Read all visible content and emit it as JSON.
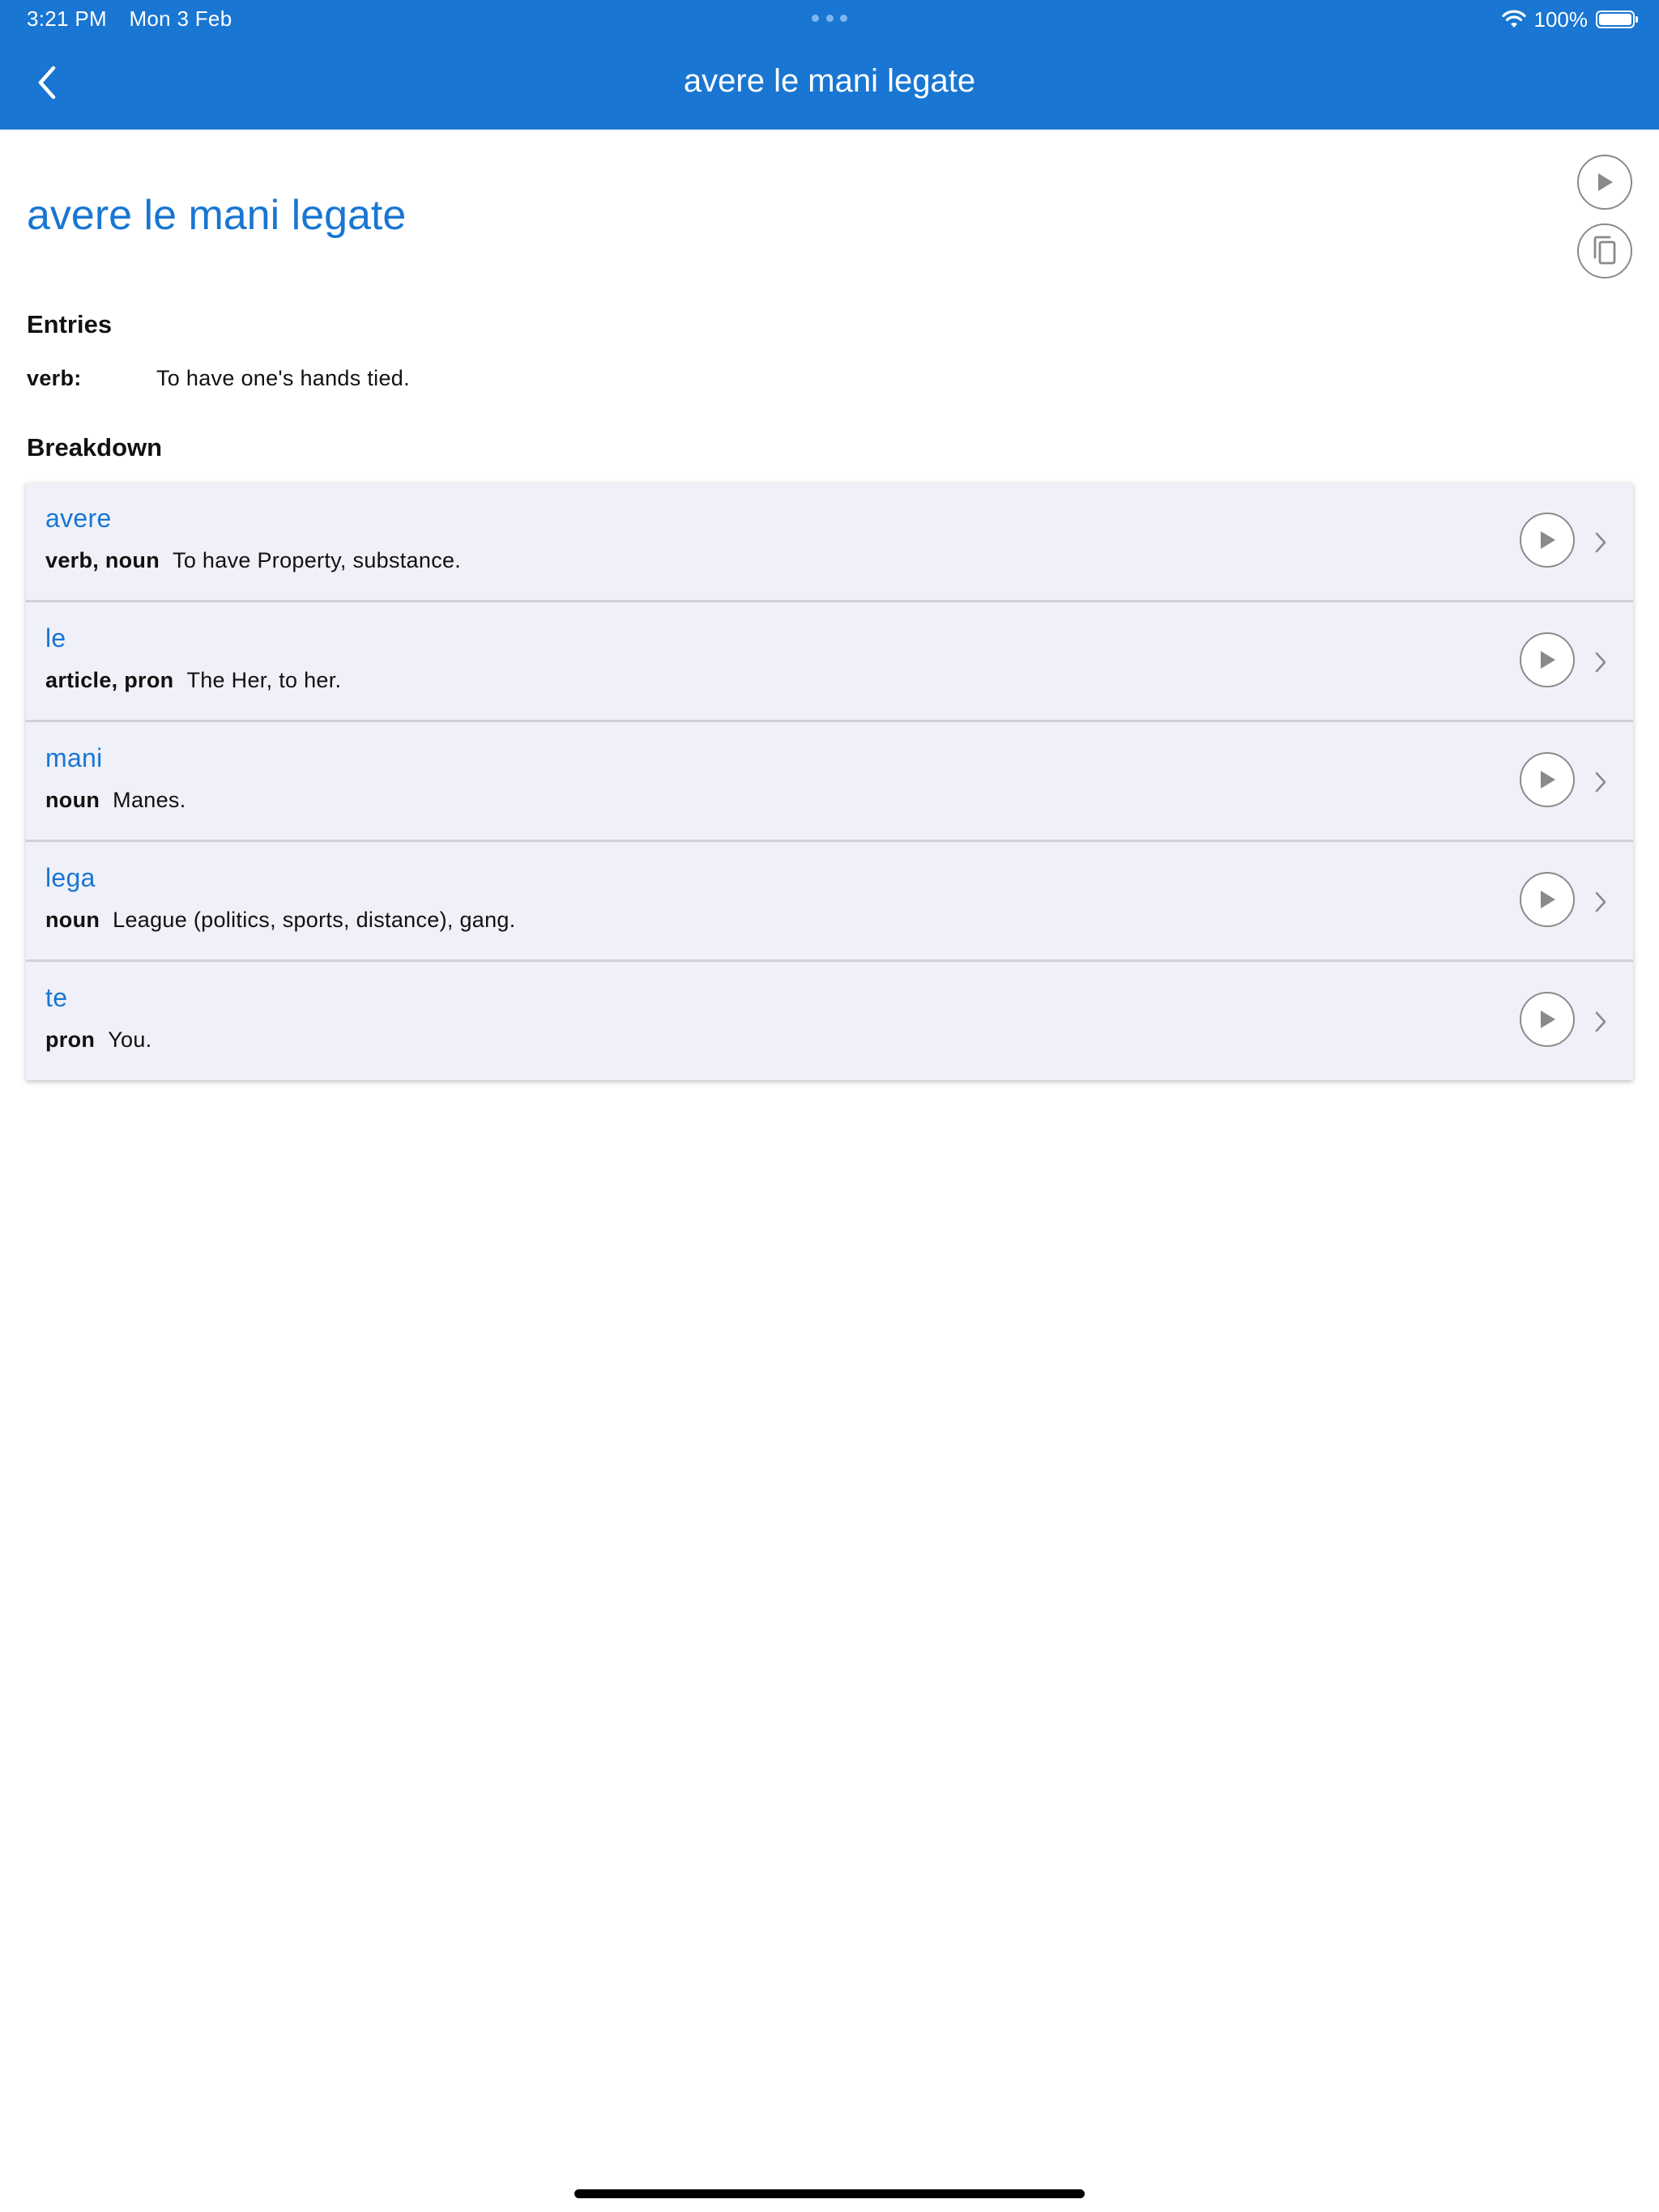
{
  "status_bar": {
    "time": "3:21 PM",
    "date": "Mon 3 Feb",
    "battery": "100%"
  },
  "nav": {
    "title": "avere le mani legate",
    "back_icon": "chevron-left-icon"
  },
  "colors": {
    "header_bg": "#1976d2",
    "accent": "#1976d2",
    "row_bg": "#f0f1f8"
  },
  "phrase": {
    "title": "avere le mani legate",
    "play_icon": "play-icon",
    "copy_icon": "copy-icon"
  },
  "entries": {
    "heading": "Entries",
    "items": [
      {
        "pos": "verb:",
        "definition": "To have one's hands tied."
      }
    ]
  },
  "breakdown": {
    "heading": "Breakdown",
    "items": [
      {
        "word": "avere",
        "pos": "verb, noun",
        "definition": "To have Property, substance."
      },
      {
        "word": "le",
        "pos": "article, pron",
        "definition": "The Her, to her."
      },
      {
        "word": "mani",
        "pos": "noun",
        "definition": "Manes."
      },
      {
        "word": "lega",
        "pos": "noun",
        "definition": "League (politics, sports, distance), gang."
      },
      {
        "word": "te",
        "pos": "pron",
        "definition": "You."
      }
    ]
  }
}
